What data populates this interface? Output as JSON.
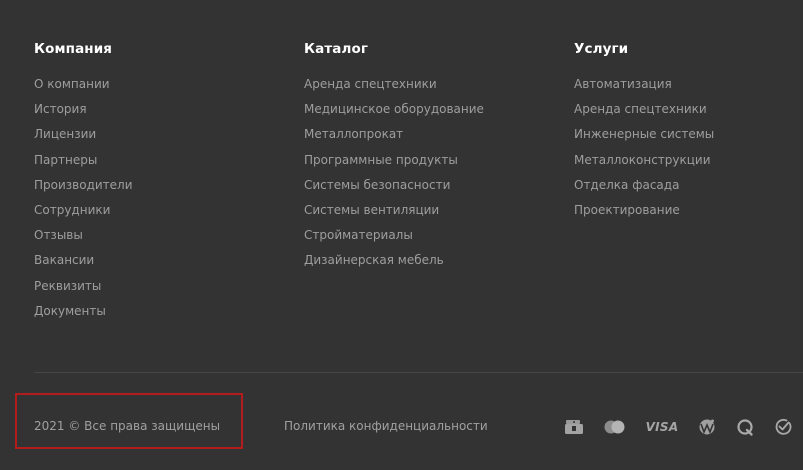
{
  "footer": {
    "columns": [
      {
        "title": "Компания",
        "links": [
          "О компании",
          "История",
          "Лицензии",
          "Партнеры",
          "Производители",
          "Сотрудники",
          "Отзывы",
          "Вакансии",
          "Реквизиты",
          "Документы"
        ]
      },
      {
        "title": "Каталог",
        "links": [
          "Аренда спецтехники",
          "Медицинское оборудование",
          "Металлопрокат",
          "Программные продукты",
          "Системы безопасности",
          "Системы вентиляции",
          "Стройматериалы",
          "Дизайнерская мебель"
        ]
      },
      {
        "title": "Услуги",
        "links": [
          "Автоматизация",
          "Аренда спецтехники",
          "Инженерные системы",
          "Металлоконструкции",
          "Отделка фасада",
          "Проектирование"
        ]
      }
    ],
    "copyright": "2021 © Все права защищены",
    "privacy_link": "Политика конфиденциальности",
    "payment_icons": {
      "visa_label": "VISA",
      "icons": [
        "sberbank-card-icon",
        "mastercard-icon",
        "visa-icon",
        "webmoney-icon",
        "qiwi-icon",
        "check-icon"
      ]
    }
  },
  "colors": {
    "background": "#333333",
    "heading": "#ffffff",
    "link": "#9e9e9e",
    "divider": "#464646",
    "highlight": "#b21c1c"
  }
}
